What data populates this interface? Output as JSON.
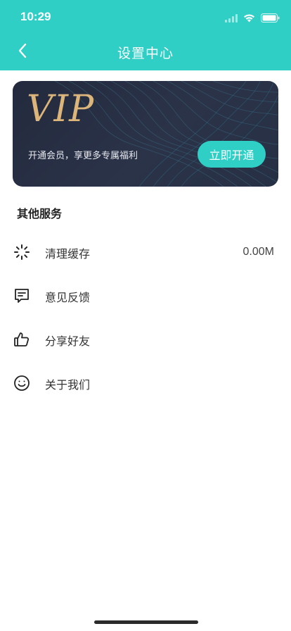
{
  "status_bar": {
    "time": "10:29"
  },
  "nav": {
    "title": "设置中心"
  },
  "vip": {
    "logo": "VIP",
    "description": "开通会员，享更多专属福利",
    "button_label": "立即开通"
  },
  "services": {
    "title": "其他服务",
    "items": [
      {
        "label": "清理缓存",
        "value": "0.00M",
        "icon": "loading-spinner-icon"
      },
      {
        "label": "意见反馈",
        "value": "",
        "icon": "feedback-message-icon"
      },
      {
        "label": "分享好友",
        "value": "",
        "icon": "thumbs-up-icon"
      },
      {
        "label": "关于我们",
        "value": "",
        "icon": "smiley-face-icon"
      }
    ]
  },
  "colors": {
    "accent": "#2fcfc6",
    "vip_card": "#262e42",
    "vip_gold": "#dcb57a"
  }
}
